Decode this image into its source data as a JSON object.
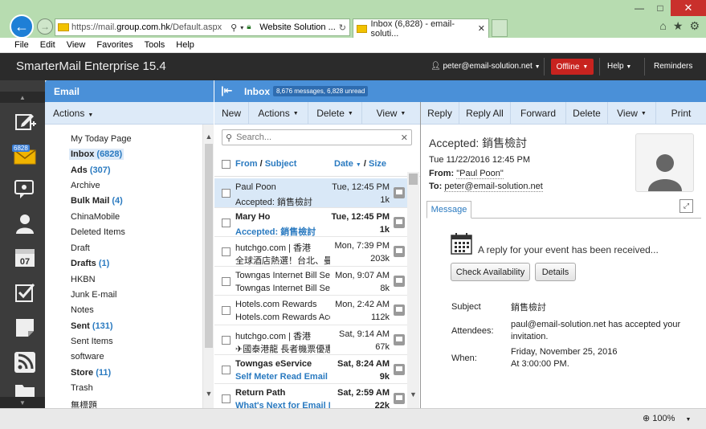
{
  "browser": {
    "url_host": "https://mail.",
    "url_domain": "group.com.hk",
    "url_path": "/Default.aspx",
    "site_identity": "Website Solution ...",
    "tab_title": "Inbox (6,828) - email-soluti...",
    "menu": [
      "File",
      "Edit",
      "View",
      "Favorites",
      "Tools",
      "Help"
    ],
    "zoom": "100%"
  },
  "app": {
    "title": "SmarterMail Enterprise 15.4",
    "user": "peter@email-solution.net",
    "status_button": "Offline",
    "help": "Help",
    "reminders": "Reminders",
    "mail_badge": "6828"
  },
  "folders": {
    "header": "Email",
    "actions": "Actions",
    "items": [
      {
        "label": "My Today Page",
        "count": "",
        "bold": false,
        "selected": false
      },
      {
        "label": "Inbox",
        "count": "(6828)",
        "bold": true,
        "selected": true
      },
      {
        "label": "Ads",
        "count": "(307)",
        "bold": true,
        "selected": false
      },
      {
        "label": "Archive",
        "count": "",
        "bold": false,
        "selected": false
      },
      {
        "label": "Bulk Mail",
        "count": "(4)",
        "bold": true,
        "selected": false
      },
      {
        "label": "ChinaMobile",
        "count": "",
        "bold": false,
        "selected": false
      },
      {
        "label": "Deleted Items",
        "count": "",
        "bold": false,
        "selected": false
      },
      {
        "label": "Draft",
        "count": "",
        "bold": false,
        "selected": false
      },
      {
        "label": "Drafts",
        "count": "(1)",
        "bold": true,
        "selected": false
      },
      {
        "label": "HKBN",
        "count": "",
        "bold": false,
        "selected": false
      },
      {
        "label": "Junk E-mail",
        "count": "",
        "bold": false,
        "selected": false
      },
      {
        "label": "Notes",
        "count": "",
        "bold": false,
        "selected": false
      },
      {
        "label": "Sent",
        "count": "(131)",
        "bold": true,
        "selected": false
      },
      {
        "label": "Sent Items",
        "count": "",
        "bold": false,
        "selected": false
      },
      {
        "label": "software",
        "count": "",
        "bold": false,
        "selected": false
      },
      {
        "label": "Store",
        "count": "(11)",
        "bold": true,
        "selected": false
      },
      {
        "label": "Trash",
        "count": "",
        "bold": false,
        "selected": false
      },
      {
        "label": "無標題",
        "count": "",
        "bold": false,
        "selected": false
      }
    ]
  },
  "inbox": {
    "title": "Inbox",
    "summary": "8,676 messages, 6,828 unread",
    "toolbar": {
      "new": "New",
      "actions": "Actions",
      "delete": "Delete",
      "view": "View"
    },
    "search_placeholder": "Search...",
    "col_from": "From",
    "col_sep1": "/",
    "col_subject": "Subject",
    "col_date": "Date",
    "col_sep2": "/",
    "col_size": "Size",
    "messages": [
      {
        "from": "Paul Poon",
        "subject": "Accepted: 銷售檢討",
        "date": "Tue, 12:45 PM",
        "size": "1k",
        "unread": false,
        "selected": true
      },
      {
        "from": "Mary Ho",
        "subject": "Accepted: 銷售檢討",
        "date": "Tue, 12:45 PM",
        "size": "1k",
        "unread": true,
        "selected": false
      },
      {
        "from": "hutchgo.com | 香港",
        "subject": "全球酒店熱選！台北、曼谷",
        "date": "Mon, 7:39 PM",
        "size": "203k",
        "unread": false,
        "selected": false
      },
      {
        "from": "Towngas Internet Bill Ser",
        "subject": "Towngas Internet Bill Ser",
        "date": "Mon, 9:07 AM",
        "size": "8k",
        "unread": false,
        "selected": false
      },
      {
        "from": "Hotels.com Rewards",
        "subject": "Hotels.com Rewards Acc",
        "date": "Mon, 2:42 AM",
        "size": "112k",
        "unread": false,
        "selected": false
      },
      {
        "from": "hutchgo.com | 香港",
        "subject": "✈國泰港龍 長者機票優惠",
        "date": "Sat, 9:14 AM",
        "size": "67k",
        "unread": false,
        "selected": false
      },
      {
        "from": "Towngas eService",
        "subject": "Self Meter Read Email R",
        "date": "Sat, 8:24 AM",
        "size": "9k",
        "unread": true,
        "selected": false
      },
      {
        "from": "Return Path",
        "subject": "What's Next for Email M",
        "date": "Sat, 2:59 AM",
        "size": "22k",
        "unread": true,
        "selected": false
      }
    ]
  },
  "reader": {
    "toolbar": {
      "reply": "Reply",
      "reply_all": "Reply All",
      "forward": "Forward",
      "delete": "Delete",
      "view": "View",
      "print": "Print"
    },
    "subject": "Accepted: 銷售檢討",
    "date": "Tue 11/22/2016 12:45 PM",
    "from_label": "From:",
    "from_value": "\"Paul Poon\"",
    "to_label": "To:",
    "to_value": "peter@email-solution.net",
    "tab": "Message",
    "invite_text": "A reply for your event has been received...",
    "btn_availability": "Check Availability",
    "btn_details": "Details",
    "subject_label": "Subject",
    "subject_value": "銷售檢討",
    "attendees_label": "Attendees:",
    "attendees_value_1": "paul@email-solution.net has accepted your",
    "attendees_value_2": "invitation.",
    "when_label": "When:",
    "when_value_1": "Friday, November 25, 2016",
    "when_value_2": "At 3:00:00 PM."
  }
}
